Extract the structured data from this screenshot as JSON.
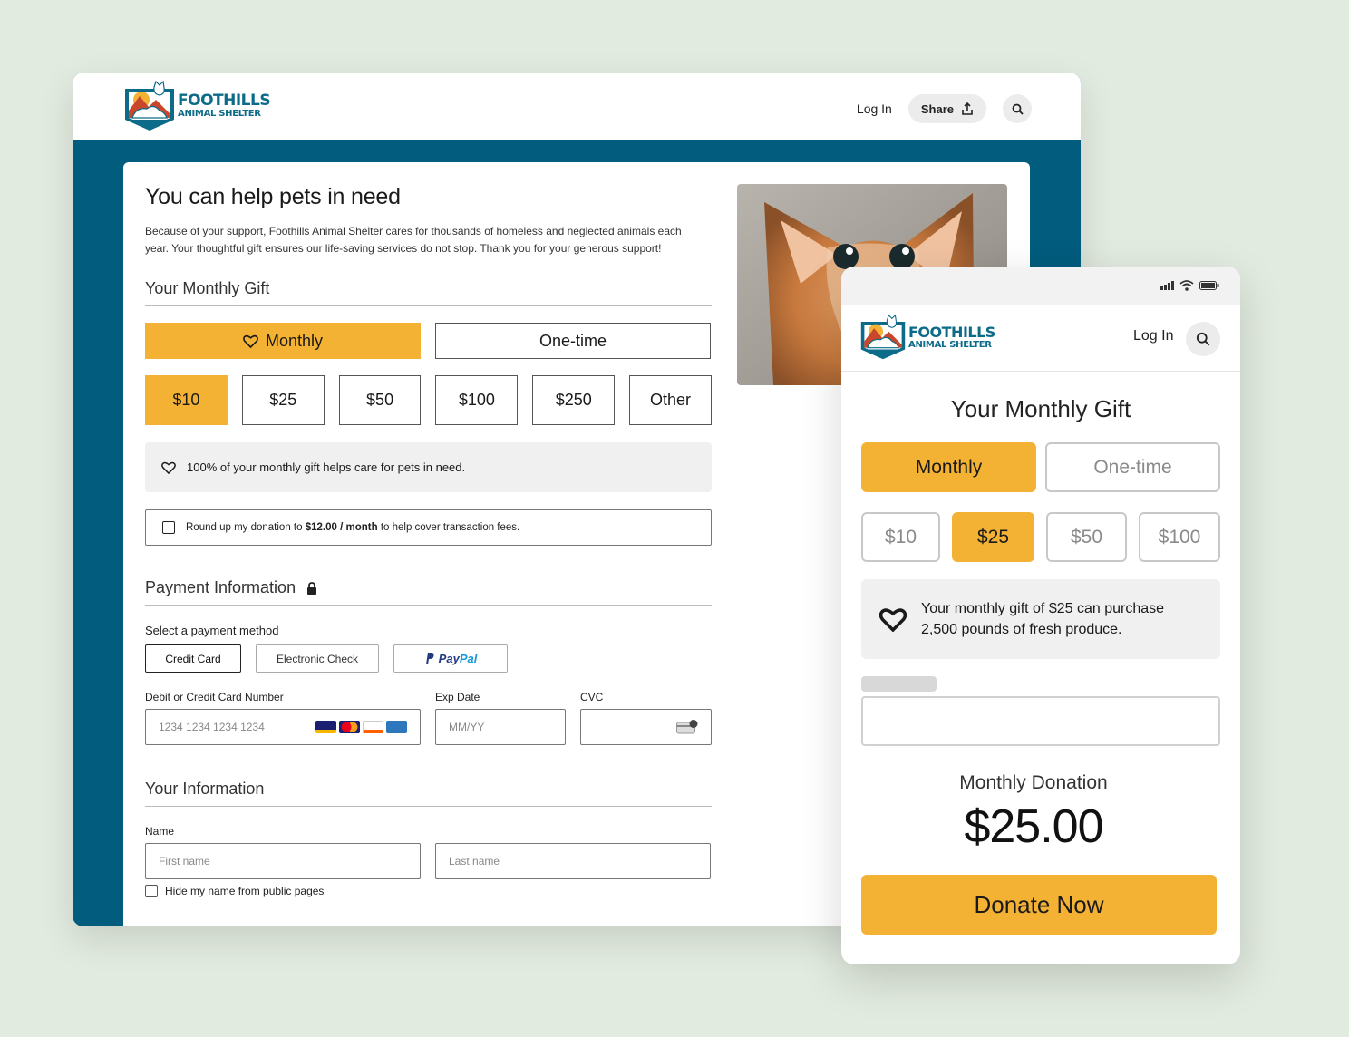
{
  "brand": {
    "line1": "FOOTHILLS",
    "line2": "ANIMAL SHELTER"
  },
  "desktop": {
    "nav": {
      "login": "Log In",
      "share": "Share"
    },
    "title": "You can help pets in need",
    "intro": "Because of your support, Foothills Animal Shelter cares for thousands of homeless and neglected animals each year. Your thoughtful gift ensures our life-saving services do not stop. Thank you for your generous support!",
    "gift_section": "Your Monthly Gift",
    "frequency": {
      "monthly": "Monthly",
      "onetime": "One-time",
      "selected": "Monthly"
    },
    "amounts": [
      "$10",
      "$25",
      "$50",
      "$100",
      "$250",
      "Other"
    ],
    "selected_amount": "$10",
    "note": "100% of your monthly gift helps care for pets in need.",
    "roundup": {
      "before": "Round up my donation to",
      "bold": "$12.00 / month",
      "after": "to help cover transaction fees.",
      "checked": false
    },
    "payment_section": "Payment Information",
    "payment_method_label": "Select a payment method",
    "payment_methods": {
      "card": "Credit Card",
      "check": "Electronic Check",
      "paypal_a": "Pay",
      "paypal_b": "Pal"
    },
    "selected_method": "Credit Card",
    "card_number": {
      "label": "Debit or Credit Card Number",
      "placeholder": "1234 1234 1234 1234"
    },
    "exp": {
      "label": "Exp Date",
      "placeholder": "MM/YY"
    },
    "cvc": {
      "label": "CVC",
      "placeholder": ""
    },
    "card_brands": [
      "VISA",
      "MC",
      "DISCOVER",
      "AMEX"
    ],
    "info_section": "Your Information",
    "name_label": "Name",
    "first_name_placeholder": "First name",
    "last_name_placeholder": "Last name",
    "hide_name": "Hide my name from public pages"
  },
  "mobile": {
    "login": "Log In",
    "title": "Your Monthly Gift",
    "frequency": {
      "monthly": "Monthly",
      "onetime": "One-time",
      "selected": "Monthly"
    },
    "amounts": [
      "$10",
      "$25",
      "$50",
      "$100"
    ],
    "selected_amount": "$25",
    "note": "Your monthly gift of $25 can purchase 2,500 pounds of fresh produce.",
    "donation_label": "Monthly Donation",
    "donation_amount": "$25.00",
    "donate_button": "Donate Now"
  },
  "colors": {
    "accent": "#f4b234",
    "brand": "#025c7d",
    "background": "#e2ebe0"
  }
}
